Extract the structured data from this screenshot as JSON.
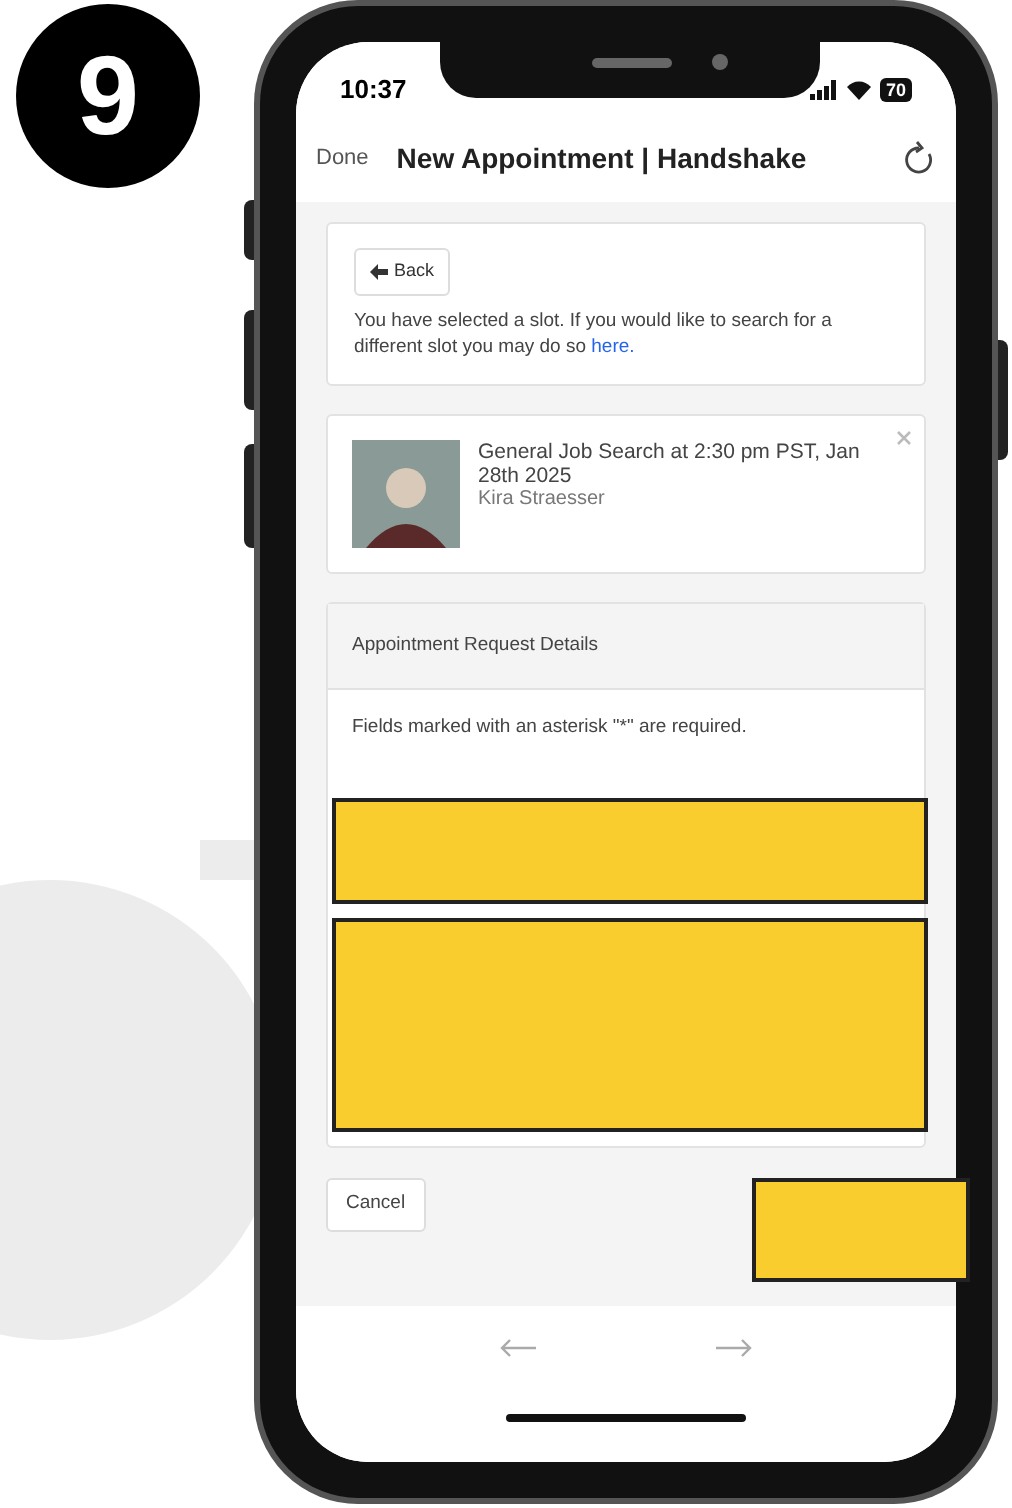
{
  "step_badge": "9",
  "status_bar": {
    "time": "10:37",
    "battery": "70"
  },
  "header": {
    "done": "Done",
    "title": "New Appointment | Handshake"
  },
  "slot_card": {
    "back_button": "Back",
    "message": "You have selected a slot. If you would like to search for a different slot you may do so ",
    "link": "here."
  },
  "appointment_card": {
    "title": "General Job Search at 2:30 pm PST, Jan 28th 2025",
    "advisor": "Kira Straesser"
  },
  "details_panel": {
    "heading": "Appointment Request Details",
    "note": "Fields marked with an asterisk \"*\" are required."
  },
  "cancel_button": "Cancel"
}
